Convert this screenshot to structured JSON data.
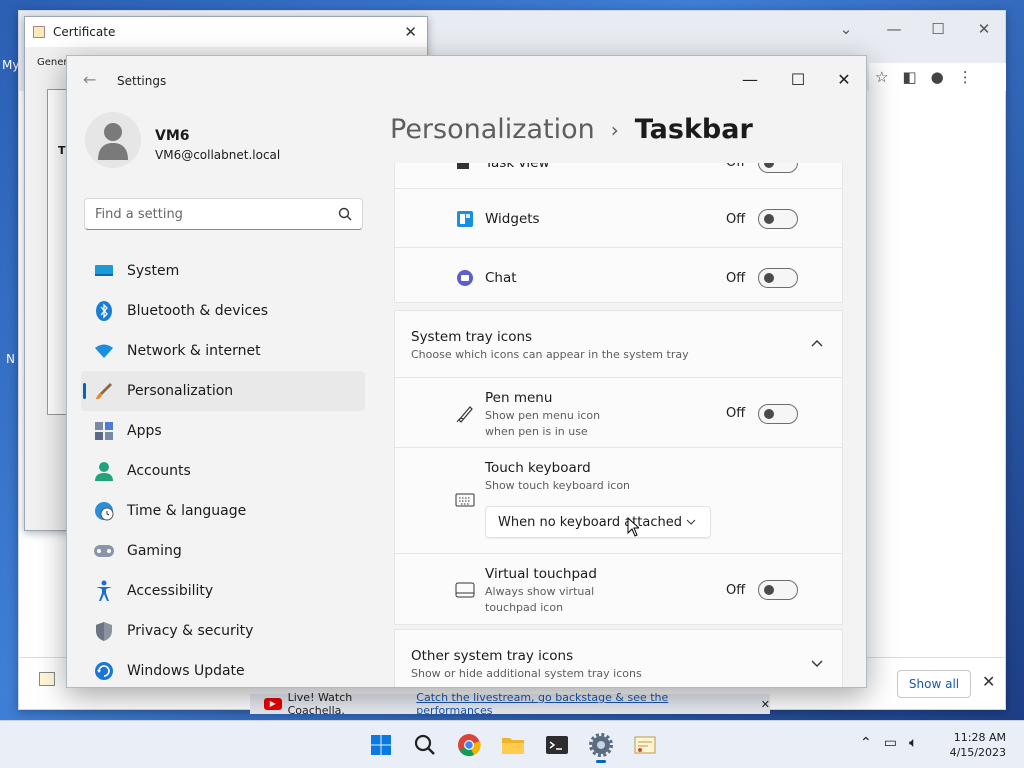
{
  "desktop": {
    "label_left_1": "My",
    "label_left_2": "N"
  },
  "chrome": {
    "show_all_label": "Show all",
    "banner_text": "Live! Watch Coachella.",
    "banner_link": "Catch the livestream, go backstage & see the performances"
  },
  "certificate": {
    "title": "Certificate",
    "tab": "Gener",
    "short_label": "T"
  },
  "settings": {
    "title": "Settings",
    "user": {
      "name": "VM6",
      "email": "VM6@collabnet.local"
    },
    "search_placeholder": "Find a setting",
    "nav": [
      {
        "label": "System",
        "icon": "system-icon"
      },
      {
        "label": "Bluetooth & devices",
        "icon": "bluetooth-icon"
      },
      {
        "label": "Network & internet",
        "icon": "wifi-icon"
      },
      {
        "label": "Personalization",
        "icon": "brush-icon",
        "selected": true
      },
      {
        "label": "Apps",
        "icon": "apps-icon"
      },
      {
        "label": "Accounts",
        "icon": "accounts-icon"
      },
      {
        "label": "Time & language",
        "icon": "clock-globe-icon"
      },
      {
        "label": "Gaming",
        "icon": "gamepad-icon"
      },
      {
        "label": "Accessibility",
        "icon": "accessibility-icon"
      },
      {
        "label": "Privacy & security",
        "icon": "shield-icon"
      },
      {
        "label": "Windows Update",
        "icon": "update-icon"
      }
    ],
    "breadcrumb": {
      "parent": "Personalization",
      "separator": "›",
      "current": "Taskbar"
    },
    "taskbar_items": {
      "task_view": {
        "label": "Task view",
        "state": "Off"
      },
      "widgets": {
        "label": "Widgets",
        "state": "Off"
      },
      "chat": {
        "label": "Chat",
        "state": "Off"
      }
    },
    "system_tray": {
      "title": "System tray icons",
      "subtitle": "Choose which icons can appear in the system tray",
      "pen_menu": {
        "label": "Pen menu",
        "desc_1": "Show pen menu icon",
        "desc_2": "when pen is in use",
        "state": "Off"
      },
      "touch_keyboard": {
        "label": "Touch keyboard",
        "desc": "Show touch keyboard icon",
        "dropdown_value": "When no keyboard attached"
      },
      "virtual_touchpad": {
        "label": "Virtual touchpad",
        "desc_1": "Always show virtual",
        "desc_2": "touchpad icon",
        "state": "Off"
      }
    },
    "other_tray": {
      "title": "Other system tray icons",
      "subtitle": "Show or hide additional system tray icons"
    }
  },
  "taskbar": {
    "apps": [
      "start-icon",
      "search-icon",
      "chrome-icon",
      "file-explorer-icon",
      "terminal-icon",
      "settings-icon",
      "certificate-icon"
    ],
    "time": "11:28 AM",
    "date": "4/15/2023"
  },
  "colors": {
    "accent": "#0067c0",
    "window_bg": "#f3f3f3",
    "card_bg": "#fbfbfb"
  }
}
